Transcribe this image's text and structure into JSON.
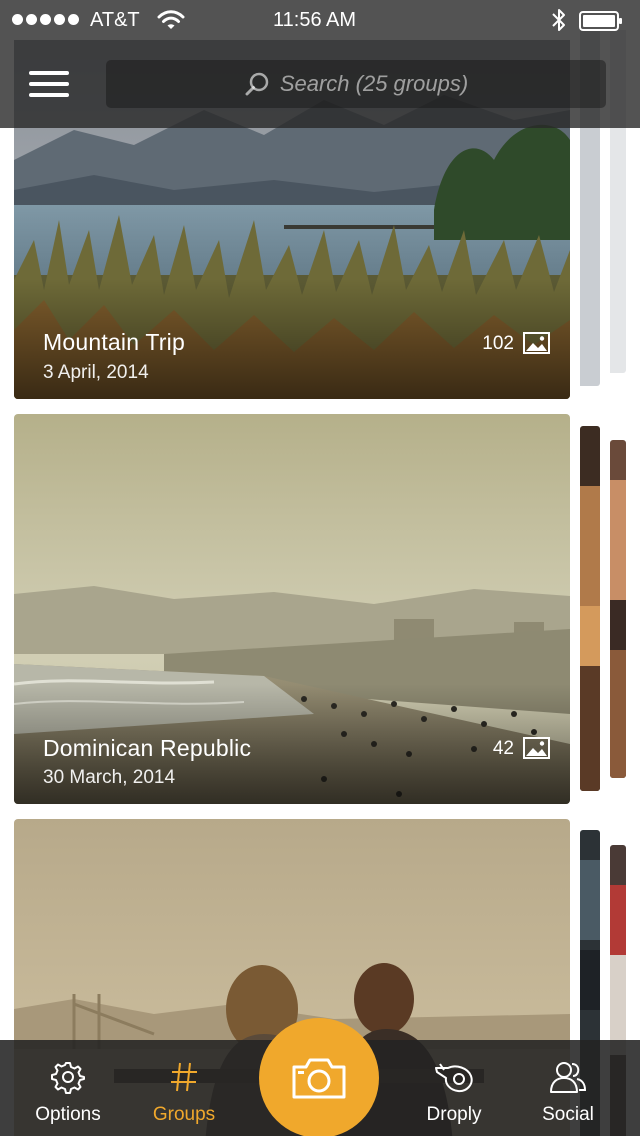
{
  "status_bar": {
    "carrier": "AT&T",
    "time": "11:56 AM",
    "signal_icon": "signal-dots-icon",
    "wifi_icon": "wifi-icon",
    "bluetooth_icon": "bluetooth-icon",
    "battery_icon": "battery-icon"
  },
  "header": {
    "menu_icon": "hamburger-menu-icon",
    "search": {
      "placeholder": "Search (25 groups)",
      "icon": "search-icon"
    }
  },
  "groups": [
    {
      "title": "Mountain Trip",
      "date": "3 April, 2014",
      "count": "102",
      "icon": "image-icon"
    },
    {
      "title": "Dominican Republic",
      "date": "30 March, 2014",
      "count": "42",
      "icon": "image-icon"
    },
    {
      "title": "",
      "date": "",
      "count": ""
    }
  ],
  "tabbar": {
    "tabs": [
      {
        "label": "Options",
        "icon": "gear-icon"
      },
      {
        "label": "Groups",
        "icon": "hash-icon",
        "active": true
      },
      {
        "label": "Droply",
        "icon": "droply-icon"
      },
      {
        "label": "Social",
        "icon": "users-icon"
      }
    ],
    "center_button_icon": "camera-icon"
  },
  "colors": {
    "accent": "#f0a82c",
    "bar_background": "#282828"
  }
}
